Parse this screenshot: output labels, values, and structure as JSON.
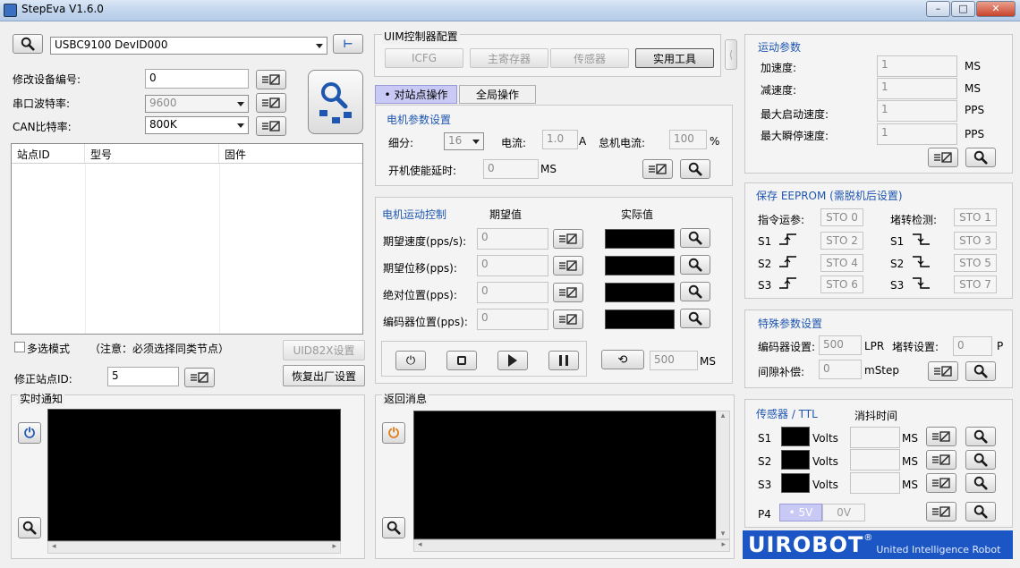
{
  "window": {
    "title": "StepEva V1.6.0"
  },
  "device": {
    "port_value": "USBC9100 DevID000",
    "modify_id_label": "修改设备编号:",
    "modify_id_value": "0",
    "baud_label": "串口波特率:",
    "baud_value": "9600",
    "can_label": "CAN比特率:",
    "can_value": "800K"
  },
  "stations": {
    "columns": [
      "站点ID",
      "型号",
      "固件"
    ],
    "multi_select_label": "多选模式",
    "note": "（注意：必须选择同类节点）",
    "uid_btn": "UID82X设置",
    "fix_id_label": "修正站点ID:",
    "fix_id_value": "5",
    "factory_btn": "恢复出厂设置"
  },
  "realtime": {
    "label": "实时通知"
  },
  "uim": {
    "title": "UIM控制器配置",
    "tabs": [
      "ICFG",
      "主寄存器",
      "传感器",
      "实用工具"
    ]
  },
  "ops": {
    "tab_station": "• 对站点操作",
    "tab_global": "全局操作"
  },
  "motor_params": {
    "title": "电机参数设置",
    "subdiv_label": "细分:",
    "subdiv_value": "16",
    "current_label": "电流:",
    "current_value": "1.0",
    "current_unit": "A",
    "idle_label": "怠机电流:",
    "idle_value": "100",
    "idle_unit": "%",
    "delay_label": "开机使能延时:",
    "delay_value": "0",
    "delay_unit": "MS"
  },
  "motion_ctrl": {
    "title": "电机运动控制",
    "col_expected": "期望值",
    "col_actual": "实际值",
    "rows": [
      {
        "label": "期望速度(pps/s):",
        "value": "0"
      },
      {
        "label": "期望位移(pps):",
        "value": "0"
      },
      {
        "label": "绝对位置(pps):",
        "value": "0"
      },
      {
        "label": "编码器位置(pps):",
        "value": "0"
      }
    ],
    "period_value": "500",
    "period_unit": "MS"
  },
  "return_msg": {
    "label": "返回消息"
  },
  "motion_params": {
    "title": "运动参数",
    "rows": [
      {
        "label": "加速度:",
        "value": "1",
        "unit": "MS"
      },
      {
        "label": "减速度:",
        "value": "1",
        "unit": "MS"
      },
      {
        "label": "最大启动速度:",
        "value": "1",
        "unit": "PPS"
      },
      {
        "label": "最大瞬停速度:",
        "value": "1",
        "unit": "PPS"
      }
    ]
  },
  "eeprom": {
    "title": "保存 EEPROM (需脱机后设置)",
    "cmd_label": "指令运参:",
    "stall_label": "堵转检测:",
    "s1": "S1",
    "s2": "S2",
    "s3": "S3",
    "sto": [
      "STO 0",
      "STO 1",
      "STO 2",
      "STO 3",
      "STO 4",
      "STO 5",
      "STO 6",
      "STO 7"
    ]
  },
  "special": {
    "title": "特殊参数设置",
    "enc_label": "编码器设置:",
    "enc_value": "500",
    "enc_unit": "LPR",
    "stall_label": "堵转设置:",
    "stall_value": "0",
    "stall_unit": "P",
    "gap_label": "间隙补偿:",
    "gap_value": "0",
    "gap_unit": "mStep"
  },
  "sensor": {
    "title": "传感器 / TTL",
    "debounce_label": "消抖时间",
    "rows": [
      {
        "label": "S1"
      },
      {
        "label": "S2"
      },
      {
        "label": "S3"
      }
    ],
    "volts": "Volts",
    "ms": "MS",
    "p4_label": "P4",
    "p4_5v": "• 5V",
    "p4_0v": "0V"
  },
  "logo": {
    "brand": "UIROBOT",
    "reg": "®",
    "tagline": "United Intelligence Robot"
  },
  "colors": {
    "accent_blue": "#1f56b0",
    "logo_bg": "#1b56c4",
    "tab_active": "#c9c9f5"
  }
}
